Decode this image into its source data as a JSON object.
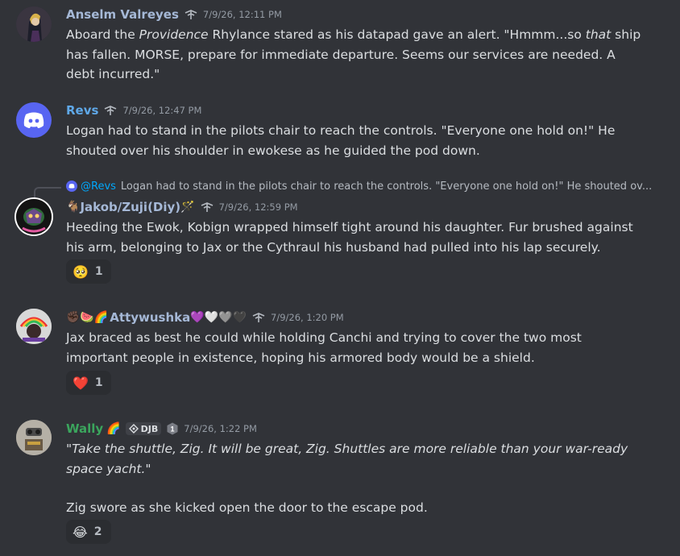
{
  "messages": [
    {
      "author": "Anselm Valreyes",
      "author_color": "#a5b8d6",
      "timestamp": "7/9/26, 12:11 PM",
      "text_parts": [
        "Aboard the ",
        "Providence",
        " Rhylance stared as his datapad gave an alert. \"Hmmm...so ",
        "that",
        " ship has fallen. MORSE, prepare for immediate departure. Seems our services are needed. A debt incurred.\""
      ]
    },
    {
      "author": "Revs",
      "author_color": "#5fa8e8",
      "timestamp": "7/9/26, 12:47 PM",
      "text": "Logan had to stand in the pilots chair to reach the controls. \"Everyone one hold on!\" He shouted over his shoulder in ewokese as he guided the pod down."
    },
    {
      "reply": {
        "mention": "@Revs",
        "text": "Logan had to stand in the pilots chair to reach the controls. \"Everyone one hold on!\" He shouted ov..."
      },
      "author_prefix_emoji": "🐐",
      "author": "Jakob/Zuji(Diy)",
      "author_suffix_emoji": "🪄",
      "author_color": "#a5b8d6",
      "timestamp": "7/9/26, 12:59 PM",
      "text": "Heeding the Ewok, Kobign wrapped himself tight around his daughter. Fur brushed against his arm, belonging to Jax or the Cythraul his husband had pulled into his lap securely.",
      "reaction": {
        "emoji": "🥺",
        "count": "1"
      }
    },
    {
      "author_prefix_emoji": "✊🏿🍉🌈",
      "author": "Attywushka",
      "author_suffix_emoji": "💜🤍🩶🖤",
      "author_color": "#a5b8d6",
      "timestamp": "7/9/26, 1:20 PM",
      "text": "Jax braced as best he could while holding Canchi and trying to cover the two most important people in existence, hoping his armored body would be a shield.",
      "reaction": {
        "emoji": "❤️",
        "count": "1"
      }
    },
    {
      "author": "Wally",
      "author_suffix_emoji": "🌈",
      "author_color": "#3ba55d",
      "tag": "DJB",
      "level": "1",
      "timestamp": "7/9/26, 1:22 PM",
      "italic_line": "\"Take the shuttle, Zig. It will be great, Zig. Shuttles are more reliable than your war-ready space yacht.\"",
      "text": "Zig swore as she kicked open the door to the escape pod.",
      "reaction": {
        "emoji": "😂",
        "count": "2"
      }
    }
  ],
  "icons": {
    "role_icon": "role-badge-icon",
    "reply_discord_icon": "discord-icon"
  },
  "colors": {
    "background": "#313338",
    "text": "#dbdee1",
    "muted": "#949ba4",
    "mention": "#00a8fc",
    "discord_blurple": "#5865f2"
  }
}
